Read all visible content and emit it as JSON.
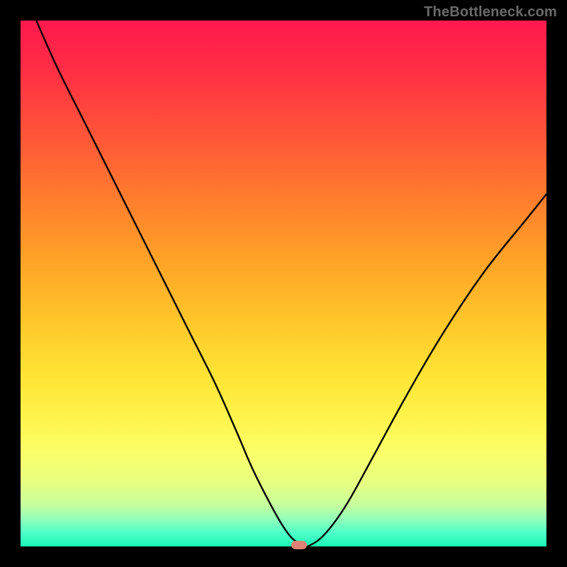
{
  "watermark": "TheBottleneck.com",
  "colors": {
    "frame": "#000000",
    "curve": "#000000",
    "marker": "#e08374"
  },
  "chart_data": {
    "type": "line",
    "title": "",
    "xlabel": "",
    "ylabel": "",
    "xlim": [
      0,
      100
    ],
    "ylim": [
      0,
      100
    ],
    "grid": false,
    "legend": false,
    "series": [
      {
        "name": "bottleneck-curve",
        "x": [
          3,
          7,
          12,
          17,
          22,
          27,
          32,
          37,
          41,
          44,
          47,
          49.5,
          51.5,
          53.5,
          55,
          58,
          62,
          67,
          73,
          80,
          88,
          96,
          100
        ],
        "y": [
          100,
          91,
          81,
          71,
          61,
          51,
          41,
          31,
          22,
          15,
          9,
          4.5,
          1.7,
          0.3,
          0.2,
          2.5,
          8,
          17,
          28,
          40,
          52,
          62,
          67
        ]
      }
    ],
    "marker": {
      "x": 53,
      "y": 0.25
    },
    "background_gradient": {
      "top": "#ff1a4d",
      "mid": "#ffe334",
      "bottom": "#18f7b4"
    }
  }
}
